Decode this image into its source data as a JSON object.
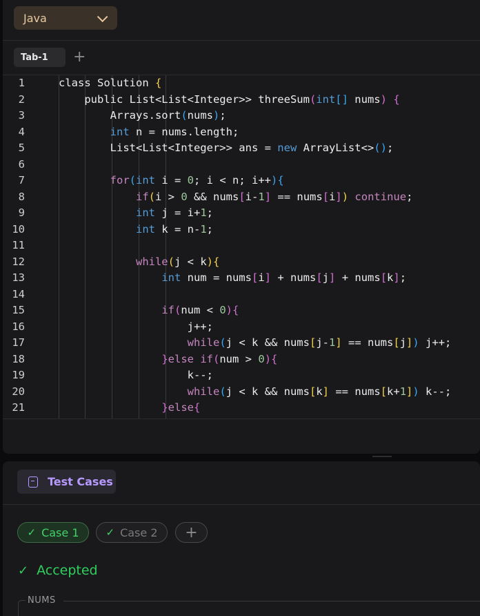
{
  "editor": {
    "language": "Java",
    "tabs": [
      {
        "label": "Tab-1"
      }
    ],
    "add_tab_label": "+",
    "lines": [
      {
        "num": "1",
        "html": "class Solution <span class=\"b1\">{</span>"
      },
      {
        "num": "2",
        "html": "    public List&lt;List&lt;Integer&gt;&gt; threeSum<span class=\"b2\">(</span><span class=\"t\">int</span><span class=\"b3\">[]</span> nums<span class=\"b2\">)</span> <span class=\"b2\">{</span>"
      },
      {
        "num": "3",
        "html": "        Arrays.sort<span class=\"b3\">(</span>nums<span class=\"b3\">)</span>;"
      },
      {
        "num": "4",
        "html": "        <span class=\"t\">int</span> n = nums.length;"
      },
      {
        "num": "5",
        "html": "        List&lt;List&lt;Integer&gt;&gt; ans = <span class=\"t\">new</span> ArrayList&lt;&gt;<span class=\"b3\">()</span>;"
      },
      {
        "num": "6",
        "html": ""
      },
      {
        "num": "7",
        "html": "        <span class=\"k\">for</span><span class=\"b3\">(</span><span class=\"t\">int</span> i = <span class=\"n\">0</span>; i &lt; n; i++<span class=\"b3\">)</span><span class=\"b3\">{</span>"
      },
      {
        "num": "8",
        "html": "            <span class=\"k\">if</span><span class=\"b1\">(</span>i &gt; <span class=\"n\">0</span> &amp;&amp; nums<span class=\"b2\">[</span>i-<span class=\"n\">1</span><span class=\"b2\">]</span> == nums<span class=\"b2\">[</span>i<span class=\"b2\">]</span><span class=\"b1\">)</span> <span class=\"k\">continue</span>;"
      },
      {
        "num": "9",
        "html": "            <span class=\"t\">int</span> j = i+<span class=\"n\">1</span>;"
      },
      {
        "num": "10",
        "html": "            <span class=\"t\">int</span> k = n-<span class=\"n\">1</span>;"
      },
      {
        "num": "11",
        "html": ""
      },
      {
        "num": "12",
        "html": "            <span class=\"k\">while</span><span class=\"b1\">(</span>j &lt; k<span class=\"b1\">)</span><span class=\"b1\">{</span>"
      },
      {
        "num": "13",
        "html": "                <span class=\"t\">int</span> num = nums<span class=\"b2\">[</span>i<span class=\"b2\">]</span> + nums<span class=\"b2\">[</span>j<span class=\"b2\">]</span> + nums<span class=\"b2\">[</span>k<span class=\"b2\">]</span>;"
      },
      {
        "num": "14",
        "html": ""
      },
      {
        "num": "15",
        "html": "                <span class=\"k\">if</span><span class=\"b2\">(</span>num &lt; <span class=\"n\">0</span><span class=\"b2\">)</span><span class=\"b2\">{</span>"
      },
      {
        "num": "16",
        "html": "                    j++;"
      },
      {
        "num": "17",
        "html": "                    <span class=\"k\">while</span><span class=\"b3\">(</span>j &lt; k &amp;&amp; nums<span class=\"b1\">[</span>j-<span class=\"n\">1</span><span class=\"b1\">]</span> == nums<span class=\"b1\">[</span>j<span class=\"b1\">]</span><span class=\"b3\">)</span> j++;"
      },
      {
        "num": "18",
        "html": "                <span class=\"b2\">}</span><span class=\"k\">else</span> <span class=\"k\">if</span><span class=\"b2\">(</span>num &gt; <span class=\"n\">0</span><span class=\"b2\">)</span><span class=\"b2\">{</span>"
      },
      {
        "num": "19",
        "html": "                    k--;"
      },
      {
        "num": "20",
        "html": "                    <span class=\"k\">while</span><span class=\"b3\">(</span>j &lt; k &amp;&amp; nums<span class=\"b1\">[</span>k<span class=\"b1\">]</span> == nums<span class=\"b1\">[</span>k+<span class=\"n\">1</span><span class=\"b1\">]</span><span class=\"b3\">)</span> k--;"
      },
      {
        "num": "21",
        "html": "                <span class=\"b2\">}</span><span class=\"k\">else</span><span class=\"b2\">{</span>"
      }
    ]
  },
  "testpanel": {
    "tab_label": "Test Cases",
    "tab_icon": "test-file-icon",
    "cases": [
      {
        "label": "Case 1",
        "status": "passed",
        "icon": "check-icon"
      },
      {
        "label": "Case 2",
        "status": "passed",
        "icon": "check-icon"
      }
    ],
    "add_case_label": "+",
    "result": "Accepted",
    "result_icon": "check-icon",
    "input_label": "NUMS"
  },
  "colors": {
    "accepted": "#2fcf5e",
    "language_chip_bg": "#3a3128",
    "test_tab_accent": "#b79aff",
    "keyword": "#c586c0",
    "type": "#569cd6"
  }
}
